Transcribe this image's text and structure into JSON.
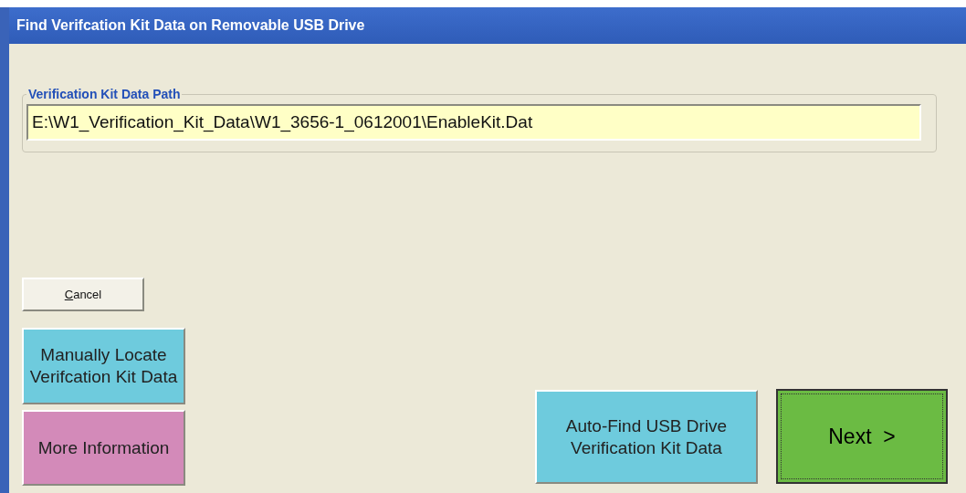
{
  "window": {
    "title": "Find Verifcation Kit Data on Removable USB Drive"
  },
  "path_group": {
    "label": "Verification Kit Data Path",
    "value": "E:\\W1_Verification_Kit_Data\\W1_3656-1_0612001\\EnableKit.Dat"
  },
  "buttons": [
    {
      "kind": "cancel",
      "label": "Cancel"
    },
    {
      "kind": "manual",
      "label": "Manually Locate Verifcation Kit Data",
      "color": "#6ecbdd"
    },
    {
      "kind": "info",
      "label": "More Information",
      "color": "#d38ab9"
    },
    {
      "kind": "auto",
      "label": "Auto-Find USB Drive Verification Kit Data",
      "color": "#6ecbdd"
    },
    {
      "kind": "next",
      "label": "Next  >",
      "color": "#6bbb43"
    }
  ]
}
